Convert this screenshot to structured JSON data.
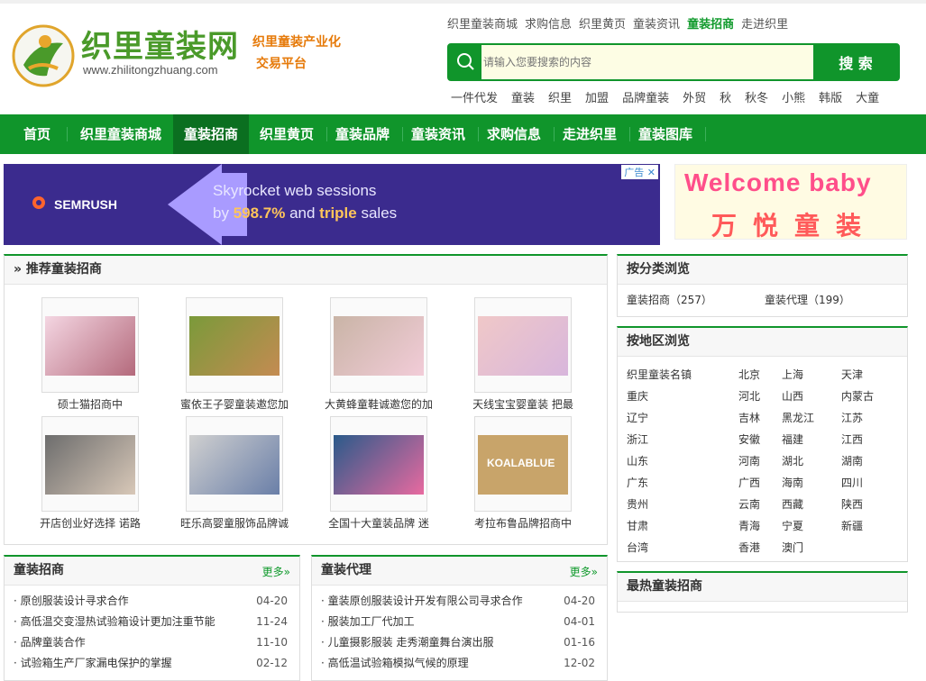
{
  "header": {
    "logo_title": "织里童装网",
    "logo_url": "www.zhilitongzhuang.com",
    "slogan_line1": "织里童装产业化",
    "slogan_line2": "交易平台",
    "top_links": [
      "织里童装商城",
      "求购信息",
      "织里黄页",
      "童装资讯",
      "童装招商",
      "走进织里"
    ],
    "search_placeholder": "请输入您要搜索的内容",
    "search_button": "搜 索",
    "hot_words": [
      "一件代发",
      "童装",
      "织里",
      "加盟",
      "品牌童装",
      "外贸",
      "秋",
      "秋冬",
      "小熊",
      "韩版",
      "大童"
    ]
  },
  "nav": [
    "首页",
    "织里童装商城",
    "童装招商",
    "织里黄页",
    "童装品牌",
    "童装资讯",
    "求购信息",
    "走进织里",
    "童装图库"
  ],
  "ads": {
    "semrush_brand": "SEMRUSH",
    "semrush_line1": "Skyrocket web sessions",
    "semrush_line2_a": "by ",
    "semrush_line2_b": "598.7%",
    "semrush_line2_c": " and ",
    "semrush_line2_d": "triple",
    "semrush_line2_e": " sales",
    "badge": "广告",
    "wanyue_en": "Welcome baby",
    "wanyue_cn": "万悦童装"
  },
  "recommend": {
    "title": "推荐童装招商",
    "items": [
      "硕士猫招商中",
      "蜜依王子婴童装邀您加",
      "大黄蜂童鞋诚邀您的加",
      "天线宝宝婴童装 把最",
      "开店创业好选择 诺路",
      "旺乐高婴童服饰品牌诚",
      "全国十大童装品牌 迷",
      "考拉布鲁品牌招商中"
    ]
  },
  "category": {
    "title": "按分类浏览",
    "items": [
      "童装招商（257）",
      "童装代理（199）"
    ]
  },
  "region": {
    "title": "按地区浏览",
    "rows": [
      [
        "织里童装名镇",
        "北京",
        "上海",
        "天津"
      ],
      [
        "重庆",
        "河北",
        "山西",
        "内蒙古"
      ],
      [
        "辽宁",
        "吉林",
        "黑龙江",
        "江苏"
      ],
      [
        "浙江",
        "安徽",
        "福建",
        "江西"
      ],
      [
        "山东",
        "河南",
        "湖北",
        "湖南"
      ],
      [
        "广东",
        "广西",
        "海南",
        "四川"
      ],
      [
        "贵州",
        "云南",
        "西藏",
        "陕西"
      ],
      [
        "甘肃",
        "青海",
        "宁夏",
        "新疆"
      ],
      [
        "台湾",
        "香港",
        "澳门",
        ""
      ]
    ]
  },
  "hottest": {
    "title": "最热童装招商"
  },
  "zhaoshang": {
    "title": "童装招商",
    "more": "更多»",
    "rows": [
      {
        "t": "· 原创服装设计寻求合作",
        "d": "04-20"
      },
      {
        "t": "· 高低温交变湿热试验箱设计更加注重节能",
        "d": "11-24"
      },
      {
        "t": "· 品牌童装合作",
        "d": "11-10"
      },
      {
        "t": "· 试验箱生产厂家漏电保护的掌握",
        "d": "02-12"
      }
    ]
  },
  "daili": {
    "title": "童装代理",
    "more": "更多»",
    "rows": [
      {
        "t": "· 童装原创服装设计开发有限公司寻求合作",
        "d": "04-20"
      },
      {
        "t": "· 服装加工厂代加工",
        "d": "04-01"
      },
      {
        "t": "· 儿童摄影服装 走秀潮童舞台演出服",
        "d": "01-16"
      },
      {
        "t": "· 高低温试验箱模拟气候的原理",
        "d": "12-02"
      }
    ]
  }
}
